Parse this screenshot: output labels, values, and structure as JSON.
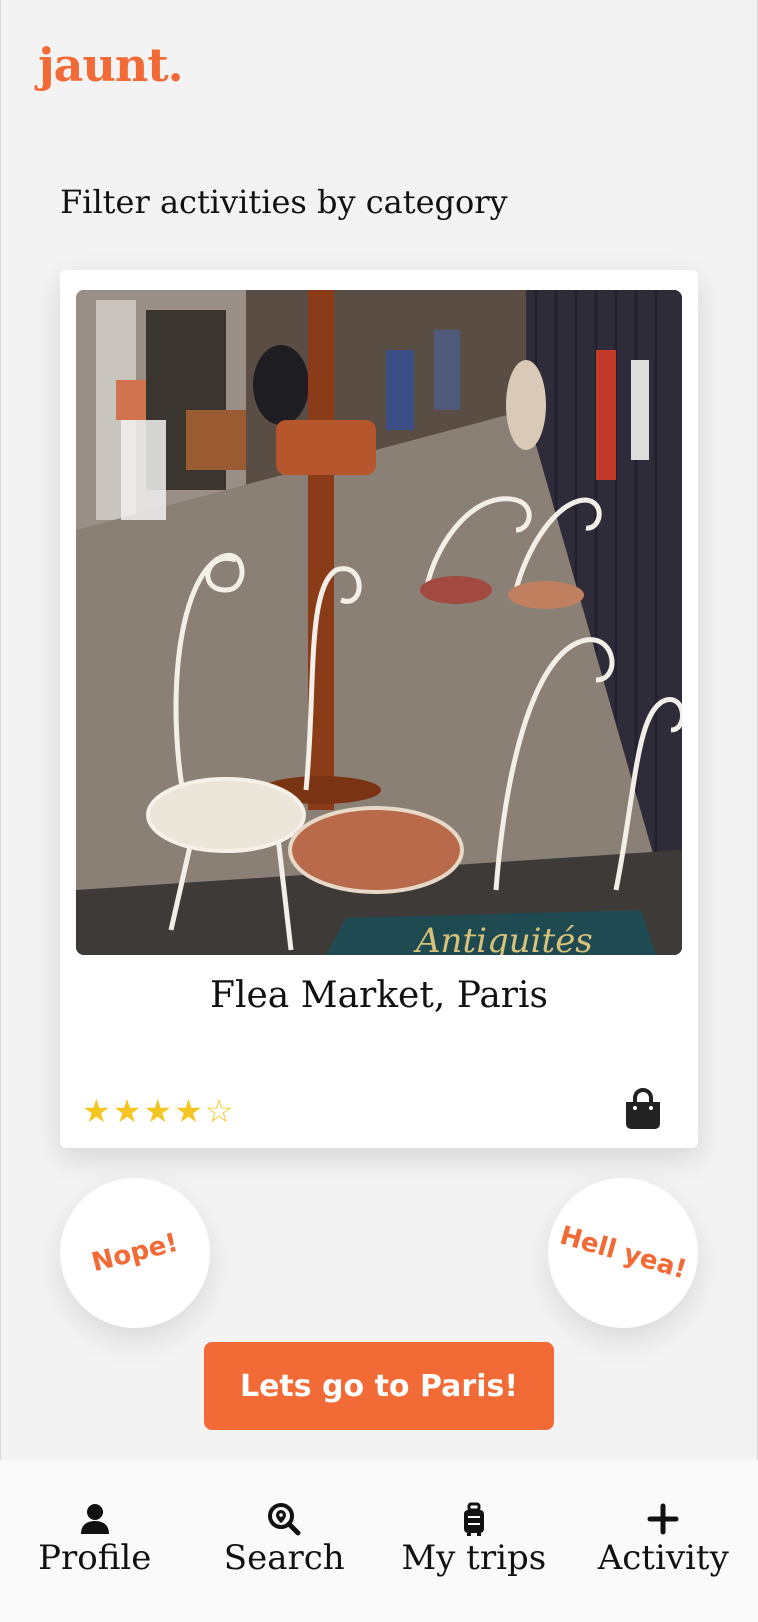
{
  "app": {
    "logo": "jaunt."
  },
  "filter": {
    "title": "Filter activities by category"
  },
  "card": {
    "title": "Flea Market, Paris",
    "rating": 4,
    "rating_max": 5,
    "category_icon": "shopping-bag-icon",
    "photo_sign": "Antiquités"
  },
  "actions": {
    "nope_label": "Nope!",
    "yea_label": "Hell yea!",
    "cta_label": "Lets go to Paris!"
  },
  "nav": {
    "items": [
      {
        "label": "Profile",
        "icon": "user-icon"
      },
      {
        "label": "Search",
        "icon": "search-location-icon"
      },
      {
        "label": "My trips",
        "icon": "suitcase-icon"
      },
      {
        "label": "Activity",
        "icon": "plus-icon"
      }
    ]
  },
  "colors": {
    "accent": "#f26a36",
    "star": "#f3c623",
    "background": "#f3f3f3"
  }
}
